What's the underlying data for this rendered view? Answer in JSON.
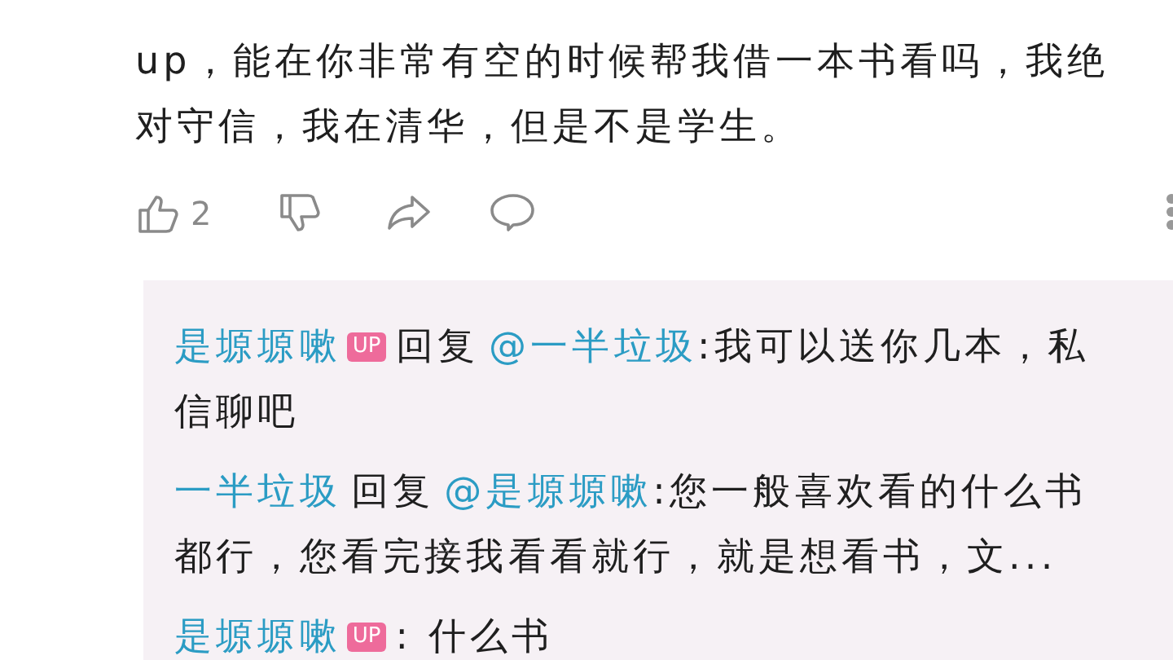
{
  "comment": {
    "lines": [
      "up，能在你非常有空的时候帮我借一本书看吗，我绝",
      "对守信，我在清华，但是不是学生。"
    ],
    "likes": "2"
  },
  "replies": [
    {
      "author": "是塬塬嗽",
      "badge": "UP",
      "verb": "回复",
      "reply_to": "@一半垃圾",
      "lines": [
        ":我可以送你几本，私",
        "信聊吧"
      ]
    },
    {
      "author": "一半垃圾",
      "verb": "回复",
      "reply_to": "@是塬塬嗽",
      "lines": [
        ":您一般喜欢看的什么书",
        "都行，您看完接我看看就行，就是想看书，文..."
      ]
    },
    {
      "author": "是塬塬嗽",
      "badge": "UP",
      "lines": [
        ": 什么书"
      ]
    }
  ]
}
